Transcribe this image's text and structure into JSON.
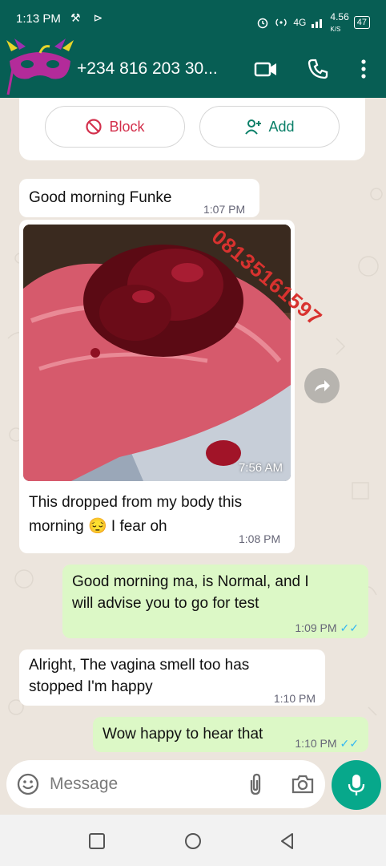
{
  "status_bar": {
    "time": "1:13 PM",
    "left_icons": "⚒ ⊳",
    "network": "4G",
    "speed": "4.56",
    "speed_unit": "K/S",
    "battery": "47"
  },
  "header": {
    "contact_name": "+234 816 203 30...",
    "icons": [
      "back-avatar",
      "video-icon",
      "phone-icon",
      "more-vert-icon"
    ]
  },
  "actions": {
    "block_label": "Block",
    "add_label": "Add"
  },
  "watermark": "08135161597",
  "messages": [
    {
      "direction": "in",
      "text": "Good morning Funke",
      "time": "1:07 PM"
    },
    {
      "direction": "in",
      "type": "photo",
      "photo_time": "7:56 AM"
    },
    {
      "direction": "in",
      "text_line1": "This dropped from my body this",
      "text_line2a": "morning",
      "emoji": "😔",
      "text_line2b": "I fear oh",
      "time": "1:08 PM"
    },
    {
      "direction": "out",
      "text_line1": "Good morning ma, is Normal, and I",
      "text_line2": "will advise you to go for test",
      "time": "1:09 PM",
      "ticks": "✓✓"
    },
    {
      "direction": "in",
      "text_line1": "Alright, The vagina smell too has",
      "text_line2": "stopped I'm happy",
      "time": "1:10 PM"
    },
    {
      "direction": "out",
      "text": "Wow happy to hear that",
      "time": "1:10 PM",
      "ticks": "✓✓"
    }
  ],
  "composer": {
    "placeholder": "Message"
  },
  "colors": {
    "header_bg": "#075e54",
    "chat_bg": "#ece5dd",
    "outgoing_bubble": "#dcf8c6",
    "incoming_bubble": "#ffffff",
    "accent": "#07a88b",
    "block_red": "#d3304c",
    "read_ticks": "#34b7f1"
  }
}
